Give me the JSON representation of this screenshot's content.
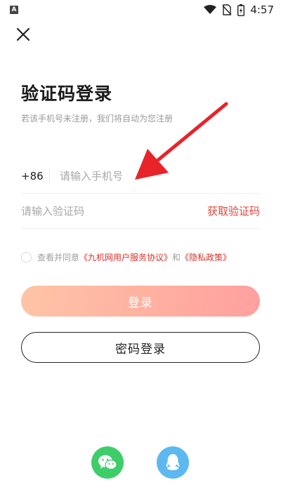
{
  "status_bar": {
    "app_icon": "A",
    "time": "4:57",
    "icons": [
      "wifi-icon",
      "no-sim-icon",
      "battery-icon"
    ]
  },
  "header": {
    "title": "验证码登录",
    "subtitle": "若该手机号未注册，我们将自动为您注册"
  },
  "form": {
    "country_code": "+86",
    "phone_placeholder": "请输入手机号",
    "code_placeholder": "请输入验证码",
    "get_code_label": "获取验证码"
  },
  "agreement": {
    "prefix": "查看并同意",
    "terms_link": "《九机网用户服务协议》",
    "connector": "和",
    "privacy_link": "《隐私政策》"
  },
  "buttons": {
    "login": "登录",
    "password_login": "密码登录"
  },
  "social": [
    "wechat-login",
    "qq-login"
  ],
  "colors": {
    "accent": "#e2453a",
    "login_gradient_start": "#ffc4a8",
    "login_gradient_end": "#ffa0a0",
    "wechat": "#3dce6a",
    "qq": "#5cb8ef",
    "annotation_arrow": "#e8232a"
  }
}
